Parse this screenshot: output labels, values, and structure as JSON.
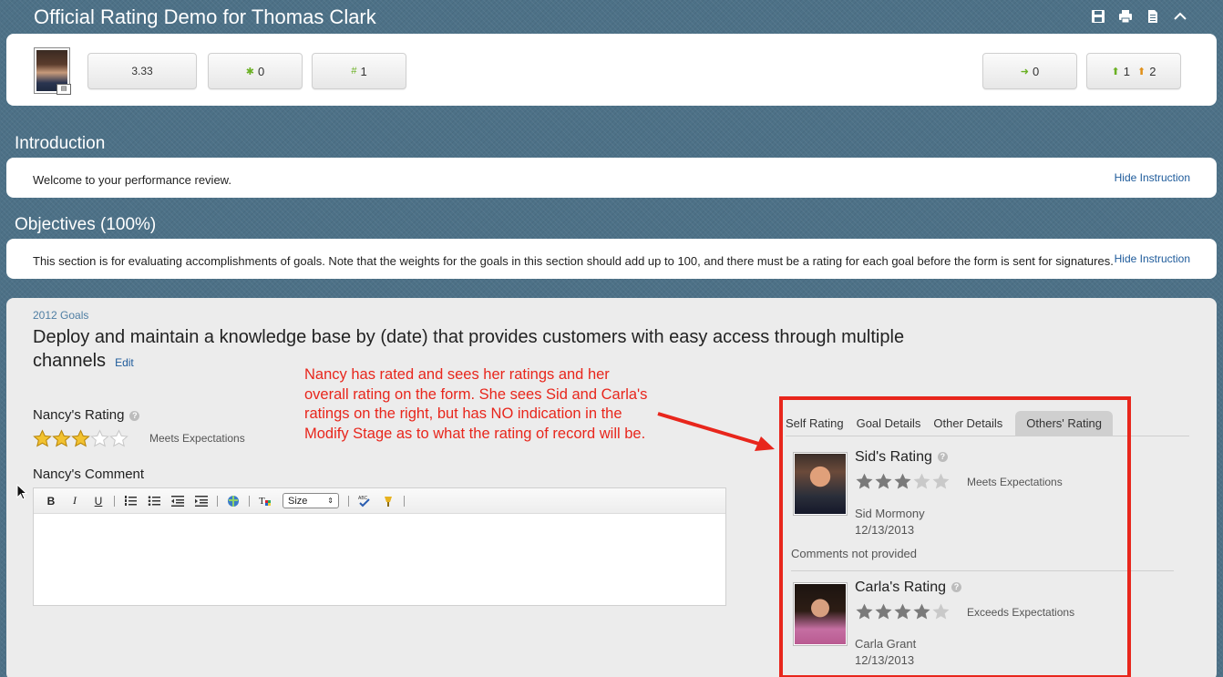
{
  "header": {
    "title": "Official Rating Demo for Thomas Clark",
    "icons": [
      "save-icon",
      "print-icon",
      "document-icon",
      "collapse-icon"
    ]
  },
  "summary": {
    "overall_rating": "3.33",
    "new_count": "0",
    "hash_count": "1",
    "right_arrow_count": "0",
    "up_green_count": "1",
    "up_orange_count": "2"
  },
  "introduction": {
    "title": "Introduction",
    "text": "Welcome to your performance review.",
    "hide_label": "Hide Instruction"
  },
  "objectives": {
    "title": "Objectives (100%)",
    "text": "This section is for evaluating accomplishments of goals. Note that the weights for the goals in this section should add up to 100, and there must be a rating for each goal before the form is sent for signatures.",
    "hide_label": "Hide Instruction"
  },
  "goal": {
    "category": "2012 Goals",
    "title": "Deploy and maintain a knowledge base by (date) that provides customers with easy access through multiple channels",
    "edit_label": "Edit"
  },
  "annotation": "Nancy has rated and sees her ratings and her overall rating on the form. She sees Sid and Carla's ratings on the right, but has NO indication in the Modify Stage as to what the rating of record will be.",
  "self_rating": {
    "label": "Nancy's Rating",
    "help": "?",
    "stars": 3,
    "max_stars": 5,
    "text": "Meets Expectations"
  },
  "comment": {
    "label": "Nancy's Comment",
    "toolbar": {
      "bold": "B",
      "italic": "I",
      "underline": "U",
      "size_label": "Size"
    }
  },
  "tabs": [
    {
      "label": "Self Rating",
      "active": false
    },
    {
      "label": "Goal Details",
      "active": false
    },
    {
      "label": "Other Details",
      "active": false
    },
    {
      "label": "Others' Rating",
      "active": true
    }
  ],
  "others": [
    {
      "title": "Sid's Rating",
      "stars": 3,
      "max_stars": 5,
      "rating_text": "Meets Expectations",
      "name": "Sid Mormony",
      "date": "12/13/2013",
      "comment": "Comments not provided"
    },
    {
      "title": "Carla's Rating",
      "stars": 4,
      "max_stars": 5,
      "rating_text": "Exceeds Expectations",
      "name": "Carla Grant",
      "date": "12/13/2013",
      "comment": ""
    }
  ],
  "colors": {
    "annotation_red": "#e8261c",
    "link_blue": "#1d5a9a",
    "star_gold": "#f2c230",
    "star_grey": "#7a7a7a"
  }
}
